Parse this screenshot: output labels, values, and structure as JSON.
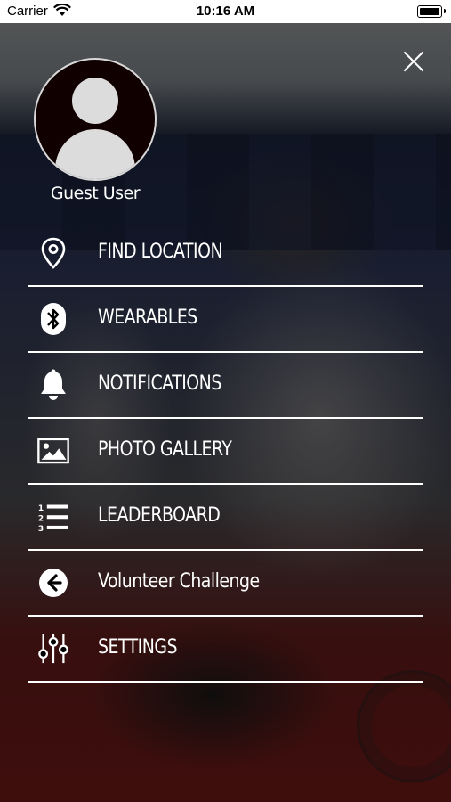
{
  "status_bar": {
    "carrier": "Carrier",
    "time": "10:16 AM"
  },
  "profile": {
    "name": "Guest User"
  },
  "menu": {
    "items": [
      {
        "label": "FIND LOCATION",
        "icon": "location-pin-icon"
      },
      {
        "label": "WEARABLES",
        "icon": "bluetooth-icon"
      },
      {
        "label": "NOTIFICATIONS",
        "icon": "bell-icon"
      },
      {
        "label": "PHOTO GALLERY",
        "icon": "image-icon"
      },
      {
        "label": "LEADERBOARD",
        "icon": "numbered-list-icon"
      },
      {
        "label": "Volunteer Challenge",
        "icon": "arrow-left-circle-icon"
      },
      {
        "label": "SETTINGS",
        "icon": "sliders-icon"
      }
    ]
  }
}
